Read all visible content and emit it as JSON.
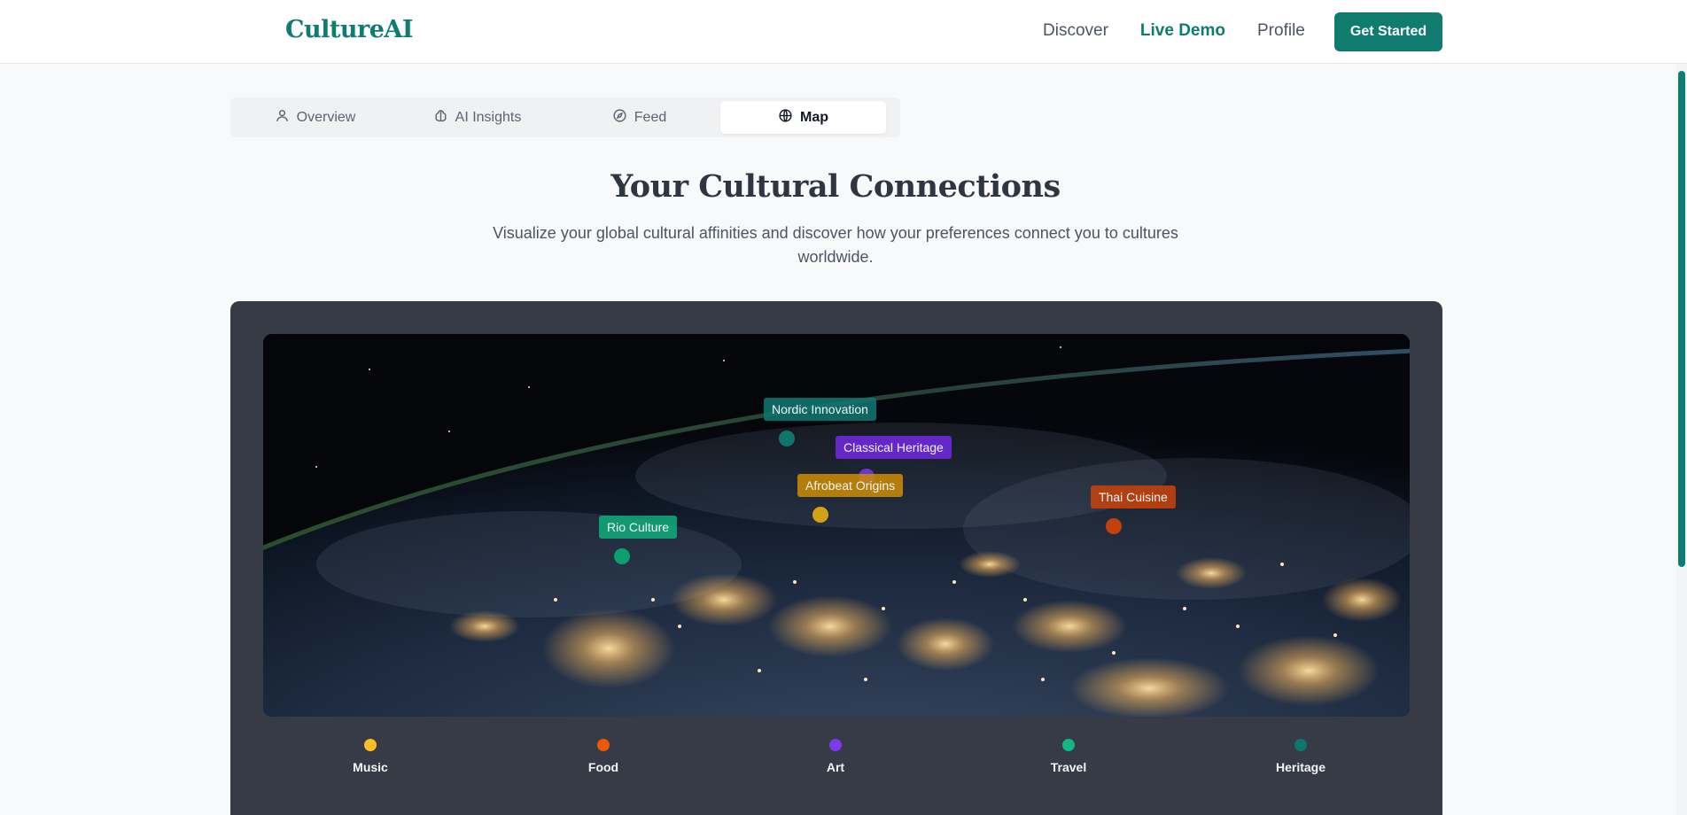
{
  "header": {
    "logo": "CultureAI",
    "nav": [
      {
        "label": "Discover",
        "active": false
      },
      {
        "label": "Live Demo",
        "active": true
      },
      {
        "label": "Profile",
        "active": false
      }
    ],
    "cta_label": "Get Started"
  },
  "tabs": [
    {
      "label": "Overview",
      "icon": "user-icon",
      "active": false
    },
    {
      "label": "AI Insights",
      "icon": "brain-icon",
      "active": false
    },
    {
      "label": "Feed",
      "icon": "compass-icon",
      "active": false
    },
    {
      "label": "Map",
      "icon": "globe-icon",
      "active": true
    }
  ],
  "section": {
    "title": "Your Cultural Connections",
    "subtitle": "Visualize your global cultural affinities and discover how your preferences connect you to cultures worldwide."
  },
  "markers": [
    {
      "label": "Nordic Innovation",
      "category": "Heritage"
    },
    {
      "label": "Classical Heritage",
      "category": "Art"
    },
    {
      "label": "Afrobeat Origins",
      "category": "Music"
    },
    {
      "label": "Thai Cuisine",
      "category": "Food"
    },
    {
      "label": "Rio Culture",
      "category": "Travel"
    }
  ],
  "legend": [
    {
      "label": "Music",
      "color": "#fbbf24"
    },
    {
      "label": "Food",
      "color": "#ea580c"
    },
    {
      "label": "Art",
      "color": "#7c3aed"
    },
    {
      "label": "Travel",
      "color": "#10b981"
    },
    {
      "label": "Heritage",
      "color": "#0f766e"
    }
  ]
}
